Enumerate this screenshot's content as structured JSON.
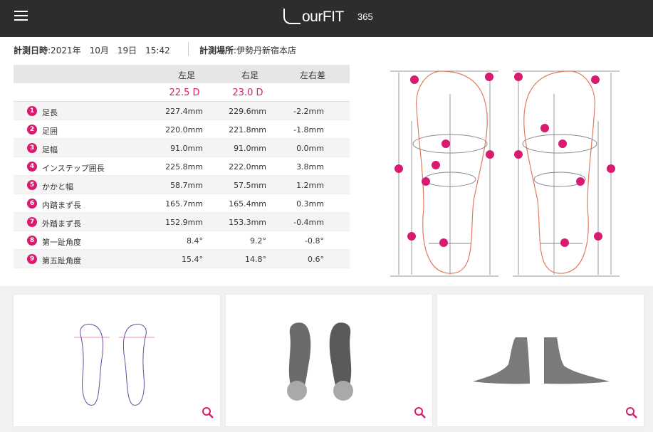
{
  "header": {
    "logo_main": "ourFIT",
    "logo_num": "365",
    "menu_icon": "hamburger-icon"
  },
  "meta": {
    "datetime_label": "計測日時",
    "datetime_value": ":2021年　10月　19日　15:42",
    "place_label": "計測場所",
    "place_value": ":伊勢丹新宿本店"
  },
  "table": {
    "headers": [
      "左足",
      "右足",
      "左右差"
    ],
    "sizes": [
      "22.5 D",
      "23.0 D"
    ],
    "rows": [
      {
        "n": "1",
        "label": "足長",
        "left": "227.4mm",
        "right": "229.6mm",
        "diff": "-2.2mm"
      },
      {
        "n": "2",
        "label": "足囲",
        "left": "220.0mm",
        "right": "221.8mm",
        "diff": "-1.8mm"
      },
      {
        "n": "3",
        "label": "足幅",
        "left": "91.0mm",
        "right": "91.0mm",
        "diff": "0.0mm"
      },
      {
        "n": "4",
        "label": "インステップ囲長",
        "left": "225.8mm",
        "right": "222.0mm",
        "diff": "3.8mm"
      },
      {
        "n": "5",
        "label": "かかと幅",
        "left": "58.7mm",
        "right": "57.5mm",
        "diff": "1.2mm"
      },
      {
        "n": "6",
        "label": "内踏まず長",
        "left": "165.7mm",
        "right": "165.4mm",
        "diff": "0.3mm"
      },
      {
        "n": "7",
        "label": "外踏まず長",
        "left": "152.9mm",
        "right": "153.3mm",
        "diff": "-0.4mm"
      },
      {
        "n": "8",
        "label": "第一趾角度",
        "left": "8.4°",
        "right": "9.2°",
        "diff": "-0.8°"
      },
      {
        "n": "9",
        "label": "第五趾角度",
        "left": "15.4°",
        "right": "14.8°",
        "diff": "0.6°"
      }
    ]
  },
  "colors": {
    "accent": "#d91b6f",
    "header_bg": "#2d2d2d",
    "foot_outline": "#e07a5f"
  },
  "cards": [
    {
      "name": "foot-outline-card",
      "icon": "zoom-icon"
    },
    {
      "name": "foot-3d-top-card",
      "icon": "zoom-icon"
    },
    {
      "name": "foot-3d-side-card",
      "icon": "zoom-icon"
    }
  ]
}
